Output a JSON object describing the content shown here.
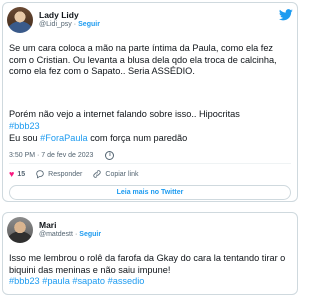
{
  "tweet1": {
    "author_name": "Lady Lidy",
    "handle": "@Lidi_psy",
    "follow_label": "Seguir",
    "paragraph1": "Se um cara coloca a mão na parte íntima da Paula, como ela fez com o Cristian. Ou levanta a blusa dela qdo ela troca de calcinha, como ela fez com o Sapato.. Seria ASSÉDIO.",
    "paragraph2": "Porém não vejo a internet falando sobre isso.. Hipocritas",
    "paragraph2_hashtag": "#bbb23",
    "paragraph3_before": "Eu sou ",
    "paragraph3_hashtag": "#ForaPaula",
    "paragraph3_after": " com força num paredão",
    "timestamp": "3:50 PM · 7 de fev de 2023",
    "likes": "15",
    "reply_label": "Responder",
    "copy_link_label": "Copiar link",
    "read_more_label": "Leia mais no Twitter"
  },
  "tweet2": {
    "author_name": "Mari",
    "handle": "@matdestt",
    "follow_label": "Seguir",
    "text": "Isso me lembrou o rolê da farofa da Gkay do cara la tentando tirar o biquini das meninas e não saiu impune!",
    "hashtags": "#bbb23 #paula #sapato #assedio"
  },
  "colors": {
    "accent": "#1d9bf0",
    "like": "#f91880",
    "muted": "#536471",
    "text": "#0f1419",
    "border": "#cfd9de"
  },
  "icons": [
    "twitter-bird-icon",
    "heart-icon",
    "reply-icon",
    "link-icon",
    "info-icon"
  ]
}
